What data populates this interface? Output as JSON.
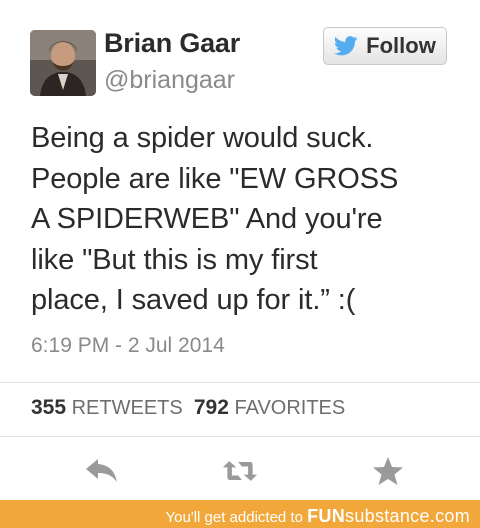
{
  "tweet": {
    "display_name": "Brian Gaar",
    "handle": "@briangaar",
    "follow_label": "Follow",
    "lines": [
      "Being a spider would suck.",
      "People are like \"EW GROSS",
      "A SPIDERWEB\" And you're",
      "like \"But this is my first",
      "place, I saved up for it.” :("
    ],
    "timestamp": "6:19 PM - 2 Jul 2014",
    "retweets_count": "355",
    "retweets_label": "RETWEETS",
    "favorites_count": "792",
    "favorites_label": "FAVORITES"
  },
  "icons": {
    "follow": "twitter-bird-icon",
    "reply": "reply-arrow-icon",
    "retweet": "retweet-icon",
    "favorite": "star-icon"
  },
  "colors": {
    "text": "#2b2b2b",
    "muted": "#8a8a8a",
    "icon": "#9a9a9a",
    "twitter_blue": "#55acee",
    "footer": "#f2a73a"
  },
  "footer": {
    "prefix": "You'll get addicted to ",
    "brand_bold": "FUN",
    "brand_rest": "substance.com"
  }
}
